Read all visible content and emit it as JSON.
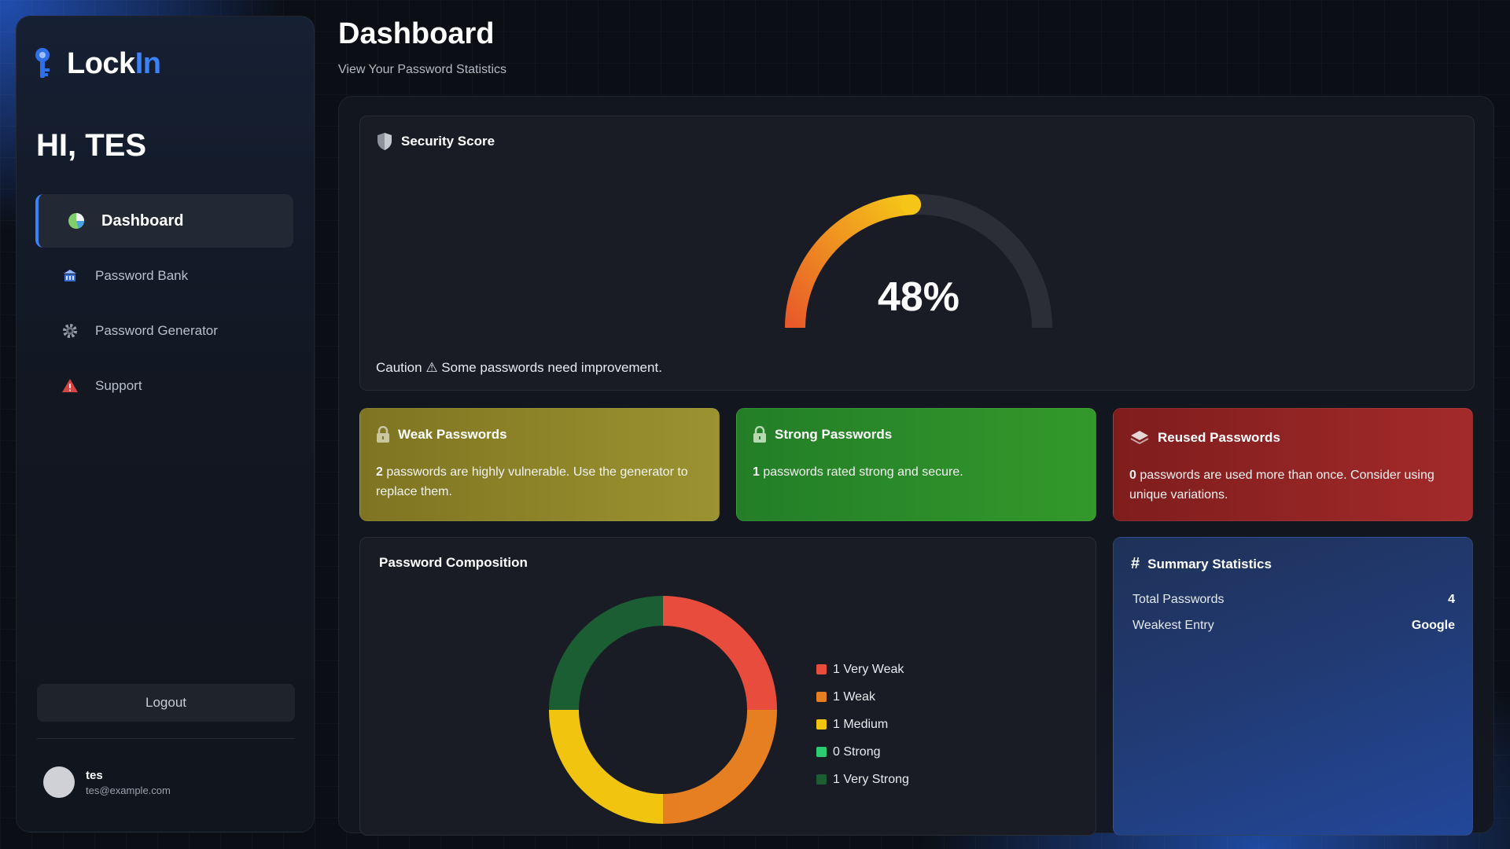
{
  "app": {
    "brand_part1": "Lock",
    "brand_part2": "In",
    "greeting": "HI, TES",
    "accent_color": "#3b82f6"
  },
  "sidebar": {
    "items": [
      {
        "label": "Dashboard",
        "icon": "pie-chart-icon",
        "active": true
      },
      {
        "label": "Password Bank",
        "icon": "bank-icon",
        "active": false
      },
      {
        "label": "Password Generator",
        "icon": "gear-icon",
        "active": false
      },
      {
        "label": "Support",
        "icon": "alert-icon",
        "active": false
      }
    ],
    "logout_label": "Logout",
    "user": {
      "name": "tes",
      "email": "tes@example.com"
    }
  },
  "header": {
    "title": "Dashboard",
    "subtitle": "View Your Password Statistics"
  },
  "security_score": {
    "title": "Security Score",
    "value": 48,
    "value_label": "48%",
    "message": "Caution ⚠ Some passwords need improvement."
  },
  "stats": {
    "weak": {
      "title": "Weak Passwords",
      "count": "2",
      "text": " passwords are highly vulnerable. Use the generator to replace them."
    },
    "strong": {
      "title": "Strong Passwords",
      "count": "1",
      "text": " passwords rated strong and secure."
    },
    "reused": {
      "title": "Reused Passwords",
      "count": "0",
      "text": " passwords are used more than once. Consider using unique variations."
    }
  },
  "composition": {
    "title": "Password Composition",
    "legend": [
      {
        "label": "1 Very Weak",
        "color": "#e74c3c"
      },
      {
        "label": "1 Weak",
        "color": "#e67e22"
      },
      {
        "label": "1 Medium",
        "color": "#f1c40f"
      },
      {
        "label": "0 Strong",
        "color": "#2ecc71"
      },
      {
        "label": "1 Very Strong",
        "color": "#1b5e33"
      }
    ]
  },
  "summary": {
    "title": "Summary Statistics",
    "rows": [
      {
        "label": "Total Passwords",
        "value": "4"
      },
      {
        "label": "Weakest Entry",
        "value": "Google"
      }
    ]
  },
  "chart_data": {
    "type": "pie",
    "categories": [
      "Very Weak",
      "Weak",
      "Medium",
      "Strong",
      "Very Strong"
    ],
    "values": [
      1,
      1,
      1,
      0,
      1
    ],
    "colors": [
      "#e74c3c",
      "#e67e22",
      "#f1c40f",
      "#2ecc71",
      "#1b5e33"
    ],
    "title": "Password Composition",
    "legend_placement": "right"
  }
}
